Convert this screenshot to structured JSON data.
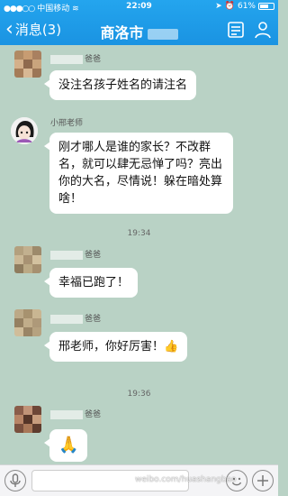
{
  "status": {
    "carrier": "中国移动",
    "time": "22:09",
    "battery": "61%"
  },
  "nav": {
    "back_label": "消息(3)",
    "title": "商洛市"
  },
  "messages": [
    {
      "sender": "爸爸",
      "text": "没注名孩子姓名的请注名"
    },
    {
      "sender": "小邢老师",
      "text": "刚才哪人是谁的家长？不改群名，就可以肆无忌惮了吗？亮出你的大名，尽情说！躲在暗处算啥！"
    },
    {
      "time": "19:34"
    },
    {
      "sender": "爸爸",
      "text": "幸福已跑了！"
    },
    {
      "sender": "爸爸",
      "text": "邢老师，你好厉害！👍"
    },
    {
      "time": "19:36"
    },
    {
      "sender": "爸爸",
      "text": "🙏"
    }
  ],
  "watermark": "weibo.com/huashangbao"
}
